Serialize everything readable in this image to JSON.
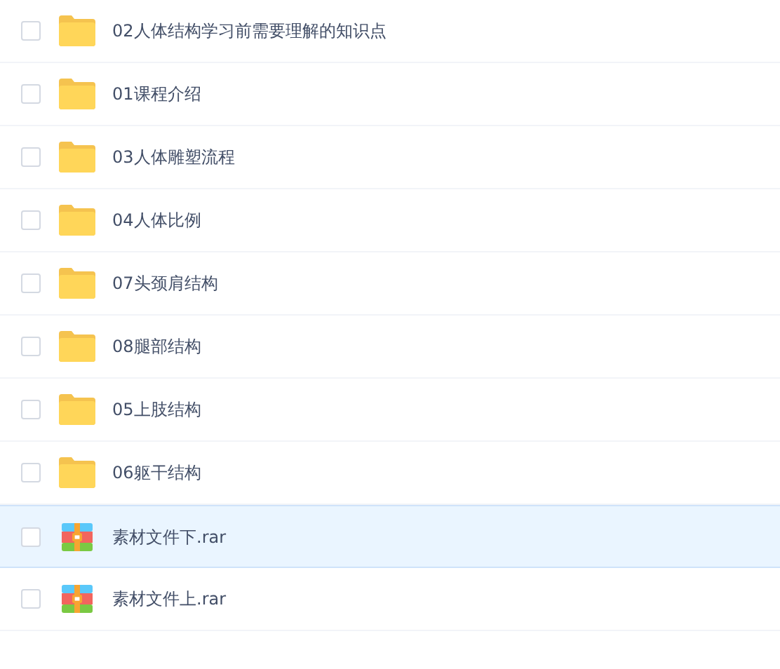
{
  "files": [
    {
      "kind": "folder",
      "name": "02人体结构学习前需要理解的知识点",
      "checked": false,
      "highlighted": false
    },
    {
      "kind": "folder",
      "name": "01课程介绍",
      "checked": false,
      "highlighted": false
    },
    {
      "kind": "folder",
      "name": "03人体雕塑流程",
      "checked": false,
      "highlighted": false
    },
    {
      "kind": "folder",
      "name": "04人体比例",
      "checked": false,
      "highlighted": false
    },
    {
      "kind": "folder",
      "name": "07头颈肩结构",
      "checked": false,
      "highlighted": false
    },
    {
      "kind": "folder",
      "name": "08腿部结构",
      "checked": false,
      "highlighted": false
    },
    {
      "kind": "folder",
      "name": "05上肢结构",
      "checked": false,
      "highlighted": false
    },
    {
      "kind": "folder",
      "name": "06躯干结构",
      "checked": false,
      "highlighted": false
    },
    {
      "kind": "archive",
      "name": "素材文件下.rar",
      "checked": false,
      "highlighted": true
    },
    {
      "kind": "archive",
      "name": "素材文件上.rar",
      "checked": false,
      "highlighted": false
    }
  ]
}
